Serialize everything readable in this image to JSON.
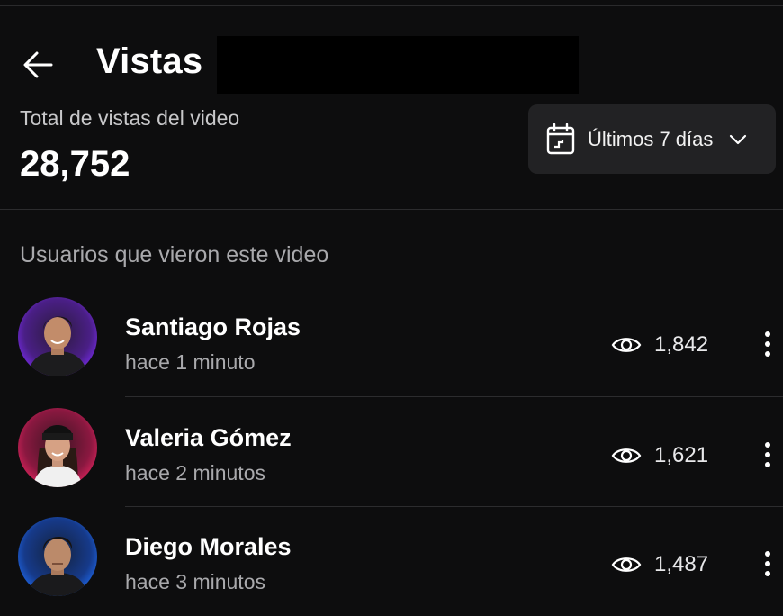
{
  "header": {
    "back_icon": "arrow-left-icon",
    "title": "Vistas"
  },
  "summary": {
    "label": "Total de vistas del video",
    "total_views": "28,752"
  },
  "date_range": {
    "icon": "calendar-icon",
    "label": "Últimos 7 días",
    "chevron_icon": "chevron-down-icon"
  },
  "viewers": {
    "heading": "Usuarios que vieron este video",
    "items": [
      {
        "name": "Santiago Rojas",
        "time": "hace 1 minuto",
        "views": "1,842",
        "avatar_accent": "#7b2cf0"
      },
      {
        "name": "Valeria Gómez",
        "time": "hace 2 minutos",
        "views": "1,621",
        "avatar_accent": "#e0245e"
      },
      {
        "name": "Diego Morales",
        "time": "hace 3 minutos",
        "views": "1,487",
        "avatar_accent": "#1f6bf0"
      }
    ]
  },
  "colors": {
    "background": "#0d0d0e",
    "surface": "#222224",
    "text_primary": "#ffffff",
    "text_secondary": "#a9a9ac"
  }
}
